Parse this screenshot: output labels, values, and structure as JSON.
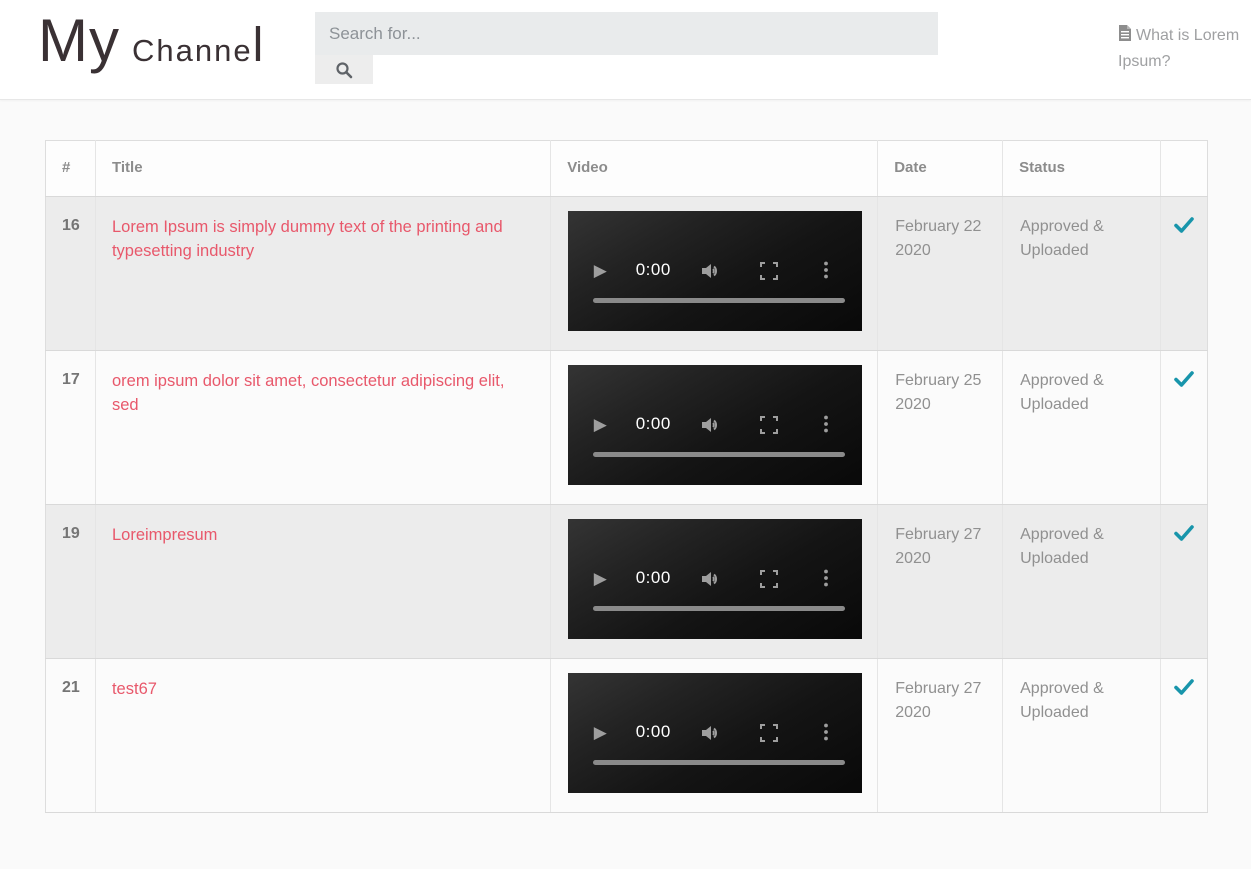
{
  "header": {
    "logo": {
      "part1": "My",
      "part2": "Channe",
      "part3": "l"
    },
    "search": {
      "placeholder": "Search for...",
      "value": ""
    },
    "help_link": {
      "label": "What is Lorem Ipsum?"
    }
  },
  "icons": {
    "search": "magnifier-glyph",
    "help": "document-glyph",
    "approved": "teal-checkmark-glyph",
    "play": "▶",
    "volume": "speaker-glyph",
    "fullscreen": "corner-brackets-glyph",
    "overflow": "vertical-dots-glyph"
  },
  "colors": {
    "accent_title": "#e8586b",
    "accent_check": "#1895ab",
    "header_bg": "#ffffff",
    "page_bg": "#fafafa",
    "stripe_bg": "#ececec"
  },
  "table": {
    "headers": [
      "#",
      "Title",
      "Video",
      "Date",
      "Status",
      ""
    ],
    "rows": [
      {
        "id": "16",
        "title": "Lorem Ipsum is simply dummy text of the printing and typesetting industry",
        "video": {
          "time": "0:00"
        },
        "date": "February 22 2020",
        "status": "Approved & Uploaded",
        "approved": true
      },
      {
        "id": "17",
        "title": "orem ipsum dolor sit amet, consectetur adipiscing elit, sed",
        "video": {
          "time": "0:00"
        },
        "date": "February 25 2020",
        "status": "Approved & Uploaded",
        "approved": true
      },
      {
        "id": "19",
        "title": "Loreimpresum",
        "video": {
          "time": "0:00"
        },
        "date": "February 27 2020",
        "status": "Approved & Uploaded",
        "approved": true
      },
      {
        "id": "21",
        "title": "test67",
        "video": {
          "time": "0:00"
        },
        "date": "February 27 2020",
        "status": "Approved & Uploaded",
        "approved": true
      }
    ]
  }
}
